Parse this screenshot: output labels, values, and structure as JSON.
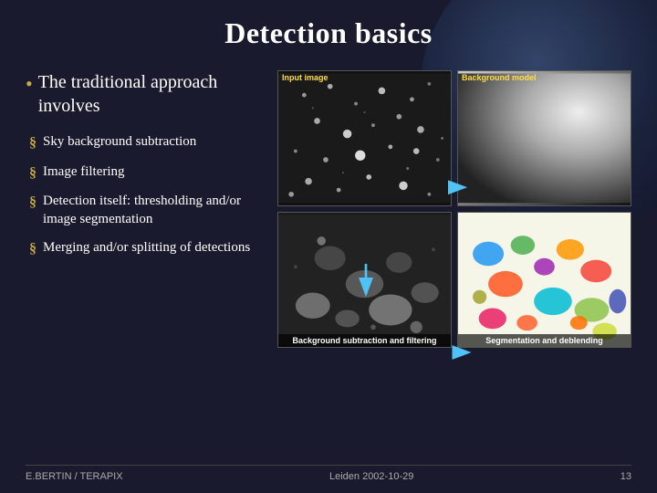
{
  "slide": {
    "title": "Detection basics",
    "main_bullet": "The traditional approach involves",
    "sub_bullets": [
      "Sky background subtraction",
      "Image filtering",
      "Detection itself: thresholding and/or image segmentation",
      "Merging and/or splitting of detections"
    ],
    "images": [
      {
        "id": "input",
        "top_label": "Input image",
        "bottom_label": ""
      },
      {
        "id": "bg_model",
        "top_label": "Background model",
        "bottom_label": ""
      },
      {
        "id": "bg_sub",
        "top_label": "",
        "bottom_label": "Background subtraction and filtering"
      },
      {
        "id": "seg",
        "top_label": "",
        "bottom_label": "Segmentation and deblending"
      }
    ]
  },
  "footer": {
    "left": "E.BERTIN / TERAPIX",
    "center": "Leiden 2002-10-29",
    "right": "13"
  }
}
